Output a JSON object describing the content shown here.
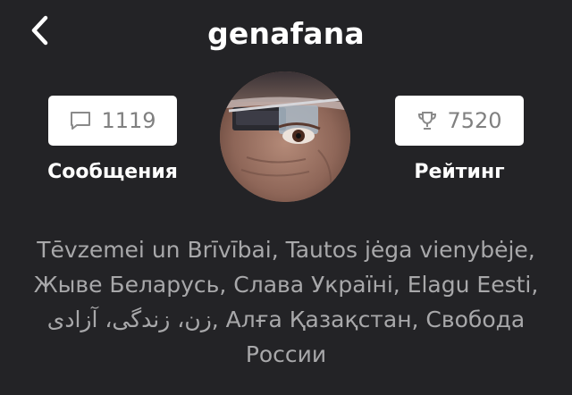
{
  "header": {
    "title": "genafana",
    "back_icon": "chevron-left-icon"
  },
  "stats": {
    "messages": {
      "icon": "chat-bubble-icon",
      "count": "1119",
      "label": "Сообщения"
    },
    "rating": {
      "icon": "trophy-icon",
      "count": "7520",
      "label": "Рейтинг"
    }
  },
  "profile": {
    "bio": "Tēvzemei un Brīvībai, Tautos jėga vienybėje, Жыве Беларусь, Слава Україні, Elagu Eesti, زن، زندگی، آزادی, Алға Қазақстан, Свобода России"
  },
  "colors": {
    "background": "#232326",
    "box_background": "#ffffff",
    "box_text": "#808080",
    "bio_text": "#a8a8aa"
  }
}
